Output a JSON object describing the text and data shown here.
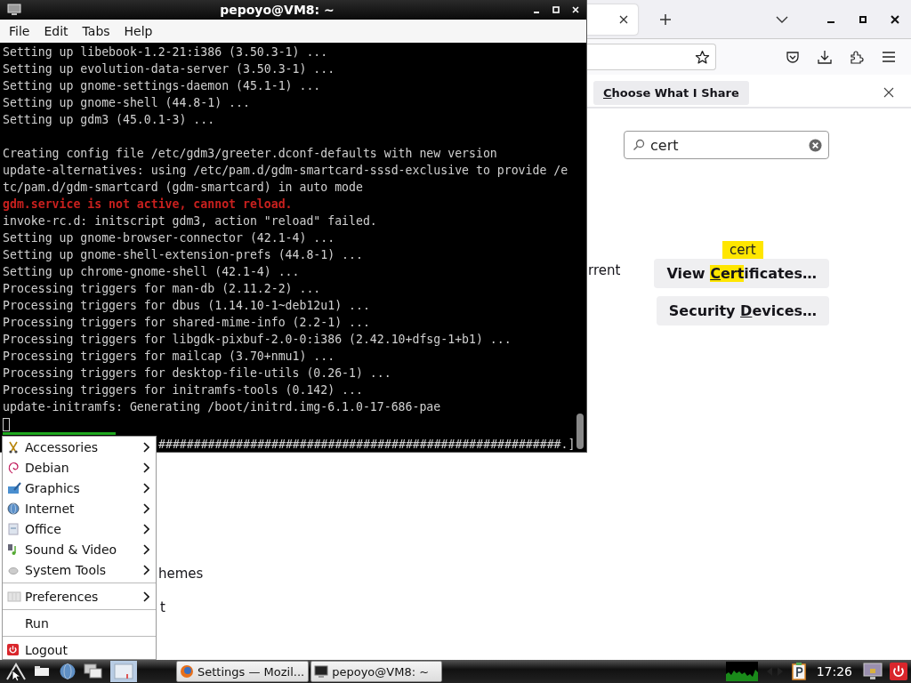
{
  "browser": {
    "notification": {
      "button": [
        {
          "text": "C",
          "access_key": true,
          "highlight": false
        },
        {
          "text": "hoose What I Share",
          "access_key": false,
          "highlight": false
        }
      ]
    },
    "search": {
      "value": "cert"
    },
    "tooltip": "cert",
    "buttons": [
      [
        {
          "text": "View ",
          "access_key": false,
          "highlight": false
        },
        {
          "text": "C",
          "access_key": true,
          "highlight": true
        },
        {
          "text": "ert",
          "access_key": false,
          "highlight": true
        },
        {
          "text": "ificates…",
          "access_key": false,
          "highlight": false
        }
      ],
      [
        {
          "text": "Security ",
          "access_key": false,
          "highlight": false
        },
        {
          "text": "D",
          "access_key": true,
          "highlight": false
        },
        {
          "text": "evices…",
          "access_key": false,
          "highlight": false
        }
      ]
    ],
    "fragments": [
      "rrent",
      "hemes",
      "t"
    ]
  },
  "terminal": {
    "title": "pepoyo@VM8: ~",
    "menu": [
      "File",
      "Edit",
      "Tabs",
      "Help"
    ],
    "lines": [
      {
        "text": "Setting up libebook-1.2-21:i386 (3.50.3-1) ...",
        "kind": "normal"
      },
      {
        "text": "Setting up evolution-data-server (3.50.3-1) ...",
        "kind": "normal"
      },
      {
        "text": "Setting up gnome-settings-daemon (45.1-1) ...",
        "kind": "normal"
      },
      {
        "text": "Setting up gnome-shell (44.8-1) ...",
        "kind": "normal"
      },
      {
        "text": "Setting up gdm3 (45.0.1-3) ...",
        "kind": "normal"
      },
      {
        "kind": "blank"
      },
      {
        "text": "Creating config file /etc/gdm3/greeter.dconf-defaults with new version",
        "kind": "normal"
      },
      {
        "text": "update-alternatives: using /etc/pam.d/gdm-smartcard-sssd-exclusive to provide /e",
        "kind": "normal"
      },
      {
        "text": "tc/pam.d/gdm-smartcard (gdm-smartcard) in auto mode",
        "kind": "normal"
      },
      {
        "text": "gdm.service is not active, cannot reload.",
        "kind": "error"
      },
      {
        "text": "invoke-rc.d: initscript gdm3, action \"reload\" failed.",
        "kind": "normal"
      },
      {
        "text": "Setting up gnome-browser-connector (42.1-4) ...",
        "kind": "normal"
      },
      {
        "text": "Setting up gnome-shell-extension-prefs (44.8-1) ...",
        "kind": "normal"
      },
      {
        "text": "Setting up chrome-gnome-shell (42.1-4) ...",
        "kind": "normal"
      },
      {
        "text": "Processing triggers for man-db (2.11.2-2) ...",
        "kind": "normal"
      },
      {
        "text": "Processing triggers for dbus (1.14.10-1~deb12u1) ...",
        "kind": "normal"
      },
      {
        "text": "Processing triggers for shared-mime-info (2.2-1) ...",
        "kind": "normal"
      },
      {
        "text": "Processing triggers for libgdk-pixbuf-2.0-0:i386 (2.42.10+dfsg-1+b1) ...",
        "kind": "normal"
      },
      {
        "text": "Processing triggers for mailcap (3.70+nmu1) ...",
        "kind": "normal"
      },
      {
        "text": "Processing triggers for desktop-file-utils (0.26-1) ...",
        "kind": "normal"
      },
      {
        "text": "Processing triggers for initramfs-tools (0.142) ...",
        "kind": "normal"
      },
      {
        "text": "update-initramfs: Generating /boot/initrd.img-6.1.0-17-686-pae",
        "kind": "normal"
      }
    ],
    "progress": "#########################################################.]"
  },
  "start_menu": {
    "groups": [
      [
        {
          "label": "Accessories",
          "submenu": true
        },
        {
          "label": "Debian",
          "submenu": true
        },
        {
          "label": "Graphics",
          "submenu": true
        },
        {
          "label": "Internet",
          "submenu": true
        },
        {
          "label": "Office",
          "submenu": true
        },
        {
          "label": "Sound & Video",
          "submenu": true
        },
        {
          "label": "System Tools",
          "submenu": true
        }
      ],
      [
        {
          "label": "Preferences",
          "submenu": true
        }
      ],
      [
        {
          "label": "Run",
          "submenu": false
        }
      ],
      [
        {
          "label": "Logout",
          "submenu": false
        }
      ]
    ]
  },
  "taskbar": {
    "tasks": [
      {
        "label": "Settings — Mozil...",
        "selected": false
      },
      {
        "label": "pepoyo@VM8: ~",
        "selected": false
      }
    ],
    "clock": "17:26"
  }
}
